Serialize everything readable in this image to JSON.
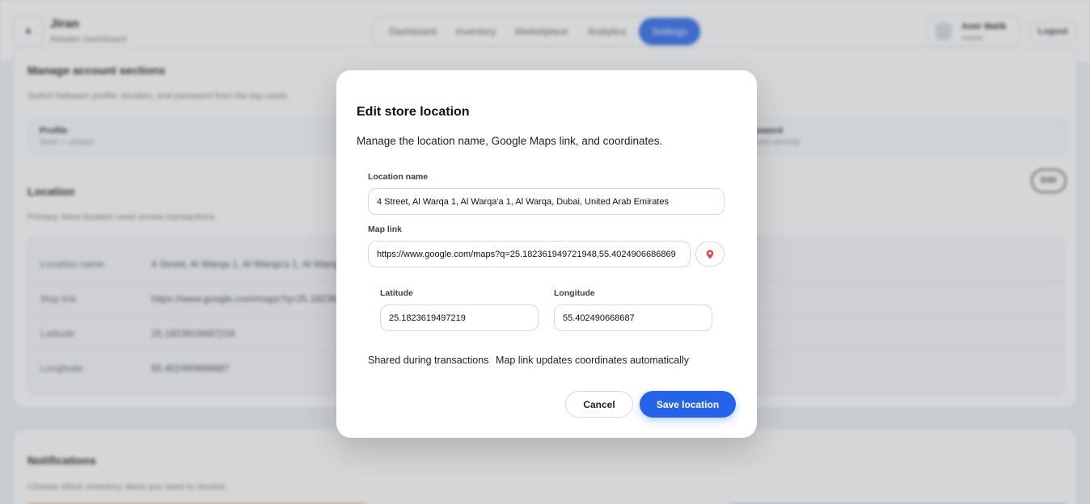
{
  "app": {
    "title": "Jiran",
    "subtitle": "Retailer Dashboard",
    "home_icon": "chevron-up-icon"
  },
  "nav": {
    "items": [
      "Dashboard",
      "Inventory",
      "Marketplace",
      "Analytics",
      "Settings"
    ],
    "active": "Settings"
  },
  "user": {
    "name": "Amir Malik",
    "role": "retailer",
    "logout_label": "Logout"
  },
  "account_sections": {
    "title": "Manage account sections",
    "description": "Switch between profile, location, and password from the top cards.",
    "tabs": [
      {
        "title": "Profile",
        "subtitle": "Store + contact"
      },
      {
        "title": "Password",
        "subtitle": "Account security"
      }
    ]
  },
  "location_section": {
    "title": "Location",
    "description": "Primary store location used across transactions.",
    "edit_label": "Edit",
    "rows": [
      {
        "key": "Location name",
        "value": "4 Street, Al Warqa 1, Al Warqa'a 1, Al Warqa, Dubai, United Arab Emirates"
      },
      {
        "key": "Map link",
        "value": "https://www.google.com/maps?q=25.182361949721948,55.4024906686869"
      },
      {
        "key": "Latitude",
        "value": "25.1823619497219"
      },
      {
        "key": "Longitude",
        "value": "55.402490668687"
      }
    ]
  },
  "notifications_section": {
    "title": "Notifications",
    "description": "Choose which inventory alerts you want to receive."
  },
  "modal": {
    "title": "Edit store location",
    "description": "Manage the location name, Google Maps link, and coordinates.",
    "location_name_label": "Location name",
    "location_name_value": "4 Street, Al Warqa 1, Al Warqa'a 1, Al Warqa, Dubai, United Arab Emirates",
    "map_link_label": "Map link",
    "map_link_value": "https://www.google.com/maps?q=25.182361949721948,55.4024906686869",
    "map_pin_icon": "map-pin-icon",
    "latitude_label": "Latitude",
    "latitude_value": "25.1823619497219",
    "longitude_label": "Longitude",
    "longitude_value": "55.402490668687",
    "hint_shared": "Shared during transactions",
    "hint_auto": "Map link updates coordinates automatically",
    "cancel_label": "Cancel",
    "save_label": "Save location",
    "accent_color": "#2563eb"
  }
}
